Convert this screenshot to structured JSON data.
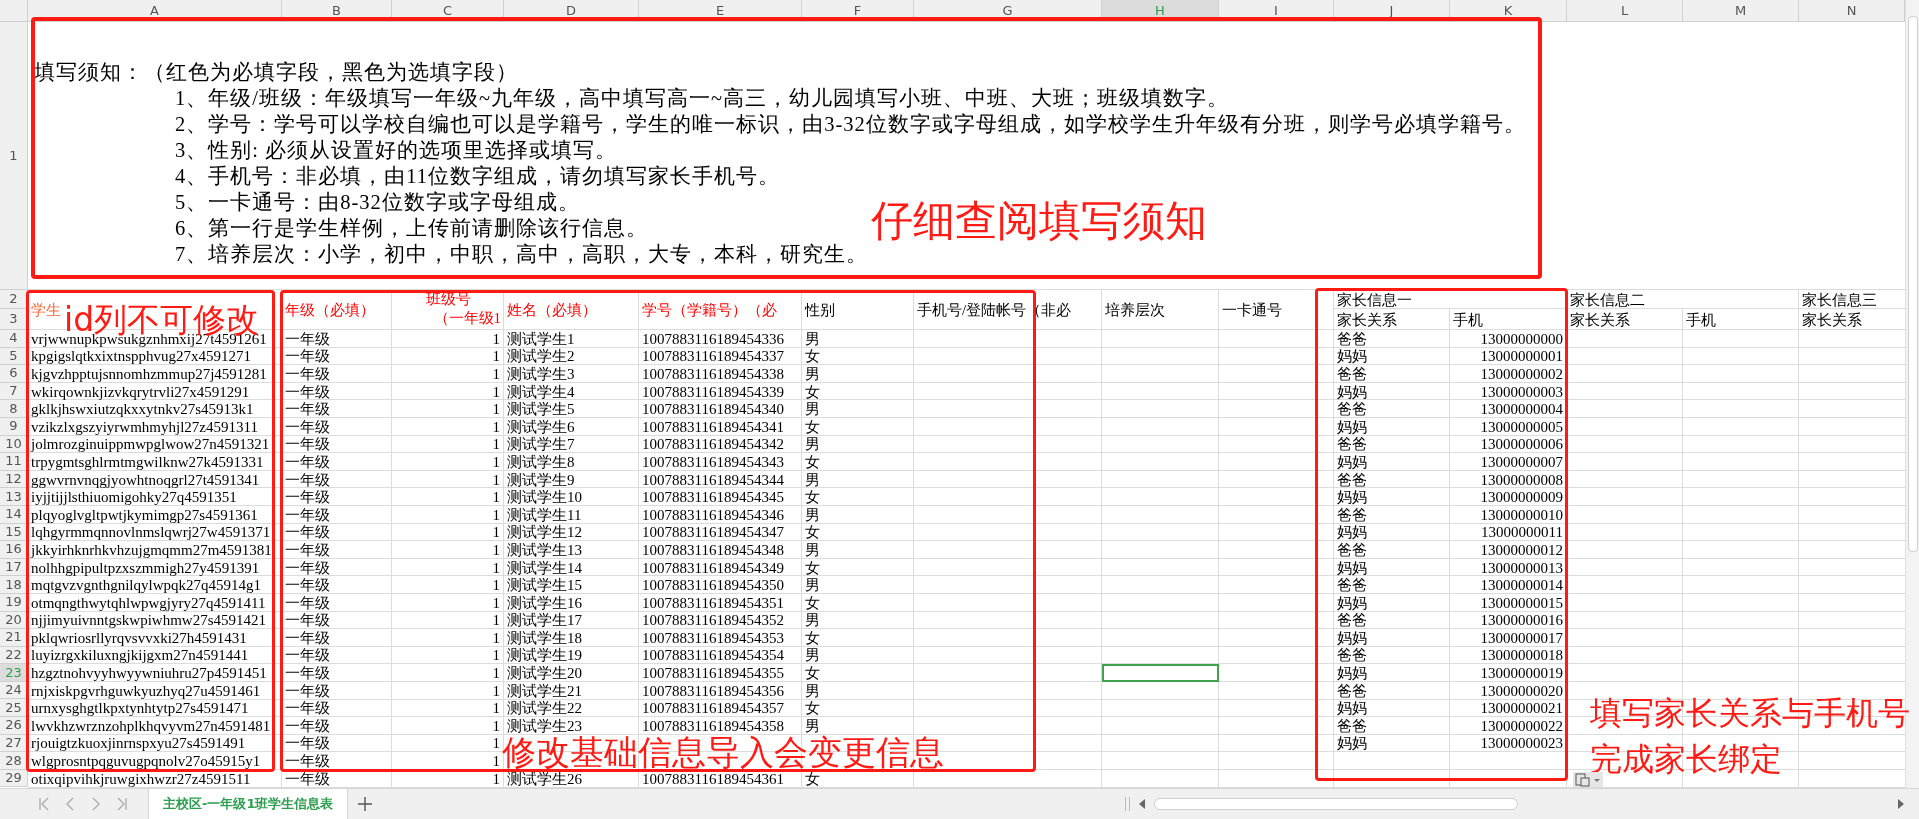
{
  "column_headers": [
    {
      "label": "A",
      "selected": false
    },
    {
      "label": "B",
      "selected": false
    },
    {
      "label": "C",
      "selected": false
    },
    {
      "label": "D",
      "selected": false
    },
    {
      "label": "E",
      "selected": false
    },
    {
      "label": "F",
      "selected": false
    },
    {
      "label": "G",
      "selected": false
    },
    {
      "label": "H",
      "selected": true
    },
    {
      "label": "I",
      "selected": false
    },
    {
      "label": "J",
      "selected": false
    },
    {
      "label": "K",
      "selected": false
    },
    {
      "label": "L",
      "selected": false
    },
    {
      "label": "M",
      "selected": false
    },
    {
      "label": "N",
      "selected": false
    }
  ],
  "instructions": {
    "row": "1",
    "title": "填写须知：（红色为必填字段，黑色为选填字段）",
    "items": [
      "1、年级/班级：年级填写一年级~九年级，高中填写高一~高三，幼儿园填写小班、中班、大班；班级填数字。",
      "2、学号：学号可以学校自编也可以是学籍号，学生的唯一标识，由3-32位数字或字母组成，如学校学生升年级有分班，则学号必填学籍号。",
      "3、性别: 必须从设置好的选项里选择或填写。",
      "4、手机号：非必填，由11位数字组成，请勿填写家长手机号。",
      "5、一卡通号：由8-32位数字或字母组成。",
      "6、第一行是学生样例，上传前请删除该行信息。",
      "7、培养层次：小学，初中，中职，高中，高职，大专，本科，研究生。"
    ]
  },
  "header": {
    "rows": [
      "2",
      "3"
    ],
    "columns": [
      {
        "text": "学生",
        "required": true
      },
      {
        "text": "年级（必填）",
        "required": true
      },
      {
        "text": "班级号",
        "subtext": "（一年级1",
        "required": true
      },
      {
        "text": "姓名（必填）",
        "required": true
      },
      {
        "text": "学号（学籍号）（必",
        "required": true
      },
      {
        "text": "性别",
        "required": false
      },
      {
        "text": "手机号/登陆帐号（非必",
        "required": false
      },
      {
        "text": "培养层次",
        "required": false
      },
      {
        "text": "一卡通号",
        "required": false
      }
    ],
    "parent_groups": [
      {
        "title": "家长信息一",
        "columns": [
          "家长关系",
          "手机"
        ]
      },
      {
        "title": "家长信息二",
        "columns": [
          "家长关系",
          "手机"
        ]
      },
      {
        "title": "家长信息三",
        "columns": [
          "家长关系"
        ]
      }
    ]
  },
  "rows": [
    {
      "row": "4",
      "id": "vrjwwnupkpwsukgznhmxij27t4591261",
      "grade": "一年级",
      "class": "1",
      "name": "测试学生1",
      "student_no": "1007883116189454336",
      "gender": "男",
      "parent_relation": "爸爸",
      "parent_phone": "13000000000",
      "selected": false
    },
    {
      "row": "5",
      "id": "kpgigslqtkxixtnspphvug27x4591271",
      "grade": "一年级",
      "class": "1",
      "name": "测试学生2",
      "student_no": "1007883116189454337",
      "gender": "女",
      "parent_relation": "妈妈",
      "parent_phone": "13000000001",
      "selected": false
    },
    {
      "row": "6",
      "id": "kjgvzhpptujsnnomhzmmup27j4591281",
      "grade": "一年级",
      "class": "1",
      "name": "测试学生3",
      "student_no": "1007883116189454338",
      "gender": "男",
      "parent_relation": "爸爸",
      "parent_phone": "13000000002",
      "selected": false
    },
    {
      "row": "7",
      "id": "wkirqownkjizvkqrytrvli27x4591291",
      "grade": "一年级",
      "class": "1",
      "name": "测试学生4",
      "student_no": "1007883116189454339",
      "gender": "女",
      "parent_relation": "妈妈",
      "parent_phone": "13000000003",
      "selected": false
    },
    {
      "row": "8",
      "id": "gklkjhswxiutzqkxxytnkv27s45913k1",
      "grade": "一年级",
      "class": "1",
      "name": "测试学生5",
      "student_no": "1007883116189454340",
      "gender": "男",
      "parent_relation": "爸爸",
      "parent_phone": "13000000004",
      "selected": false
    },
    {
      "row": "9",
      "id": "vzikzlxgszyiyrwmhmyhjl27z4591311",
      "grade": "一年级",
      "class": "1",
      "name": "测试学生6",
      "student_no": "1007883116189454341",
      "gender": "女",
      "parent_relation": "妈妈",
      "parent_phone": "13000000005",
      "selected": false
    },
    {
      "row": "10",
      "id": "jolmrozginuippmwpglwow27n4591321",
      "grade": "一年级",
      "class": "1",
      "name": "测试学生7",
      "student_no": "1007883116189454342",
      "gender": "男",
      "parent_relation": "爸爸",
      "parent_phone": "13000000006",
      "selected": false
    },
    {
      "row": "11",
      "id": "trpygmtsghlrmtmgwilknw27k4591331",
      "grade": "一年级",
      "class": "1",
      "name": "测试学生8",
      "student_no": "1007883116189454343",
      "gender": "女",
      "parent_relation": "妈妈",
      "parent_phone": "13000000007",
      "selected": false
    },
    {
      "row": "12",
      "id": "ggwvrnvnqgjyowhtnoqgrl27t4591341",
      "grade": "一年级",
      "class": "1",
      "name": "测试学生9",
      "student_no": "1007883116189454344",
      "gender": "男",
      "parent_relation": "爸爸",
      "parent_phone": "13000000008",
      "selected": false
    },
    {
      "row": "13",
      "id": "iyjjtijjlsthiuomigohky27q4591351",
      "grade": "一年级",
      "class": "1",
      "name": "测试学生10",
      "student_no": "1007883116189454345",
      "gender": "女",
      "parent_relation": "妈妈",
      "parent_phone": "13000000009",
      "selected": false
    },
    {
      "row": "14",
      "id": "plqyoglvgltpwtjkymimgp27s4591361",
      "grade": "一年级",
      "class": "1",
      "name": "测试学生11",
      "student_no": "1007883116189454346",
      "gender": "男",
      "parent_relation": "爸爸",
      "parent_phone": "13000000010",
      "selected": false
    },
    {
      "row": "15",
      "id": "lqhgyrmmqnnovlnmslqwrj27w4591371",
      "grade": "一年级",
      "class": "1",
      "name": "测试学生12",
      "student_no": "1007883116189454347",
      "gender": "女",
      "parent_relation": "妈妈",
      "parent_phone": "13000000011",
      "selected": false
    },
    {
      "row": "16",
      "id": "jkkyirhknrhkvhzujgmqmm27m4591381",
      "grade": "一年级",
      "class": "1",
      "name": "测试学生13",
      "student_no": "1007883116189454348",
      "gender": "男",
      "parent_relation": "爸爸",
      "parent_phone": "13000000012",
      "selected": false
    },
    {
      "row": "17",
      "id": "nolhhgpipultpzxszmmigh27y4591391",
      "grade": "一年级",
      "class": "1",
      "name": "测试学生14",
      "student_no": "1007883116189454349",
      "gender": "女",
      "parent_relation": "妈妈",
      "parent_phone": "13000000013",
      "selected": false
    },
    {
      "row": "18",
      "id": "mqtgvzvgnthgnilqylwpqk27q45914g1",
      "grade": "一年级",
      "class": "1",
      "name": "测试学生15",
      "student_no": "1007883116189454350",
      "gender": "男",
      "parent_relation": "爸爸",
      "parent_phone": "13000000014",
      "selected": false
    },
    {
      "row": "19",
      "id": "otmqngthwytqhlwpwgjyry27q4591411",
      "grade": "一年级",
      "class": "1",
      "name": "测试学生16",
      "student_no": "1007883116189454351",
      "gender": "女",
      "parent_relation": "妈妈",
      "parent_phone": "13000000015",
      "selected": false
    },
    {
      "row": "20",
      "id": "njjimyuivnntgskwpiwhmw27s4591421",
      "grade": "一年级",
      "class": "1",
      "name": "测试学生17",
      "student_no": "1007883116189454352",
      "gender": "男",
      "parent_relation": "爸爸",
      "parent_phone": "13000000016",
      "selected": false
    },
    {
      "row": "21",
      "id": "pklqwriosrllyrqvsvvxki27h4591431",
      "grade": "一年级",
      "class": "1",
      "name": "测试学生18",
      "student_no": "1007883116189454353",
      "gender": "女",
      "parent_relation": "妈妈",
      "parent_phone": "13000000017",
      "selected": false
    },
    {
      "row": "22",
      "id": "luyizrgxkiluxngjkijgxm27n4591441",
      "grade": "一年级",
      "class": "1",
      "name": "测试学生19",
      "student_no": "1007883116189454354",
      "gender": "男",
      "parent_relation": "爸爸",
      "parent_phone": "13000000018",
      "selected": false
    },
    {
      "row": "23",
      "id": "hzgztnohvyyhwyywniuhru27p4591451",
      "grade": "一年级",
      "class": "1",
      "name": "测试学生20",
      "student_no": "1007883116189454355",
      "gender": "女",
      "parent_relation": "妈妈",
      "parent_phone": "13000000019",
      "selected": true
    },
    {
      "row": "24",
      "id": "rnjxiskpgvrhguwkyuzhyq27u4591461",
      "grade": "一年级",
      "class": "1",
      "name": "测试学生21",
      "student_no": "1007883116189454356",
      "gender": "男",
      "parent_relation": "爸爸",
      "parent_phone": "13000000020",
      "selected": false
    },
    {
      "row": "25",
      "id": "urnxysghgtlkpxtynhtytp27s4591471",
      "grade": "一年级",
      "class": "1",
      "name": "测试学生22",
      "student_no": "1007883116189454357",
      "gender": "女",
      "parent_relation": "妈妈",
      "parent_phone": "13000000021",
      "selected": false
    },
    {
      "row": "26",
      "id": "lwvkhzwrznzohplkhqvyvm27n4591481",
      "grade": "一年级",
      "class": "1",
      "name": "测试学生23",
      "student_no": "1007883116189454358",
      "gender": "男",
      "parent_relation": "爸爸",
      "parent_phone": "13000000022",
      "selected": false
    },
    {
      "row": "27",
      "id": "rjouigtzkuoxjinrnspxyu27s4591491",
      "grade": "一年级",
      "class": "1",
      "parent_relation": "妈妈",
      "parent_phone": "13000000023",
      "selected": false
    },
    {
      "row": "28",
      "id": "wlgprosntpqguvugpqnolv27o45915y1",
      "grade": "一年级",
      "class": "1",
      "selected": false
    },
    {
      "row": "29",
      "id": "otixqipvihkjruwgixhwzr27z4591511",
      "grade": "一年级",
      "class": "1",
      "name": "测试学生26",
      "student_no": "1007883116189454361",
      "gender": "女",
      "selected": false
    }
  ],
  "annotation_notes": [
    {
      "lines": [
        "仔细查阅填写须知"
      ]
    },
    {
      "lines": [
        "id列不可修改"
      ]
    },
    {
      "lines": [
        "修改基础信息导入会变更信息"
      ]
    },
    {
      "lines": [
        "填写家长关系与手机号",
        "完成家长绑定"
      ]
    }
  ],
  "sheet_tabs": [
    {
      "label": "主校区-一年级1班学生信息表",
      "selected": true
    }
  ]
}
